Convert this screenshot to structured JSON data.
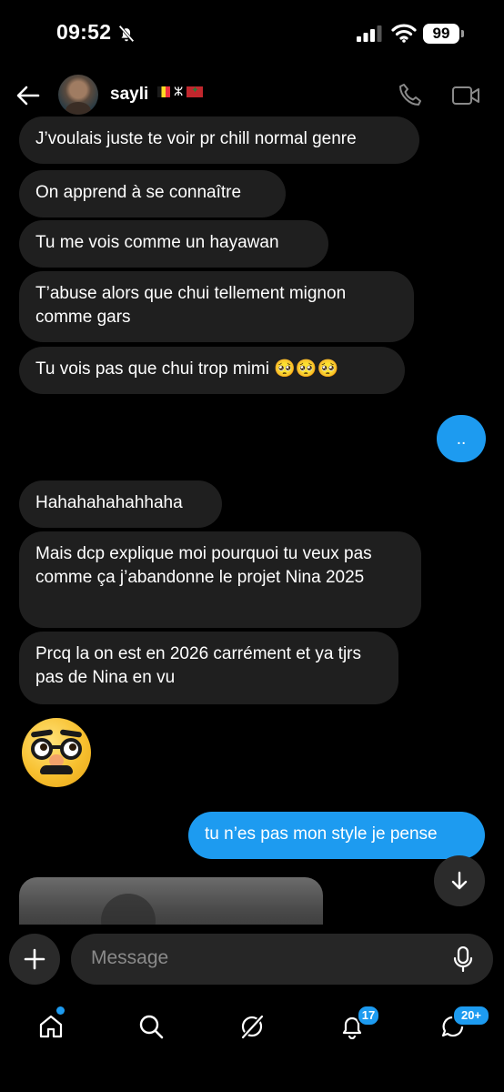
{
  "status_bar": {
    "time": "09:52",
    "battery": "99"
  },
  "header": {
    "contact_name": "sayli"
  },
  "messages": [
    {
      "text": "J’voulais juste te voir pr chill normal genre"
    },
    {
      "text": "On apprend à se connaître"
    },
    {
      "text": "Tu me vois comme un hayawan"
    },
    {
      "text": "T’abuse alors que chui tellement mignon comme gars"
    },
    {
      "text": "Tu vois pas que chui trop mimi 🥺🥺🥺"
    },
    {
      "text": ".."
    },
    {
      "text": "Hahahahahahhaha"
    },
    {
      "text": "Mais dcp explique moi pourquoi tu veux pas comme ça j’abandonne le projet Nina 2025"
    },
    {
      "text": "Prcq la on est en 2026 carrément et ya tjrs pas de Nina en vu"
    },
    {
      "text": "tu n’es pas mon style je pense"
    }
  ],
  "composer": {
    "placeholder": "Message"
  },
  "tabbar": {
    "notifications_badge": "17",
    "messages_badge": "20+"
  },
  "colors": {
    "accent": "#1d9bf0",
    "incoming_bubble": "#1f1f1f",
    "background": "#000000"
  }
}
